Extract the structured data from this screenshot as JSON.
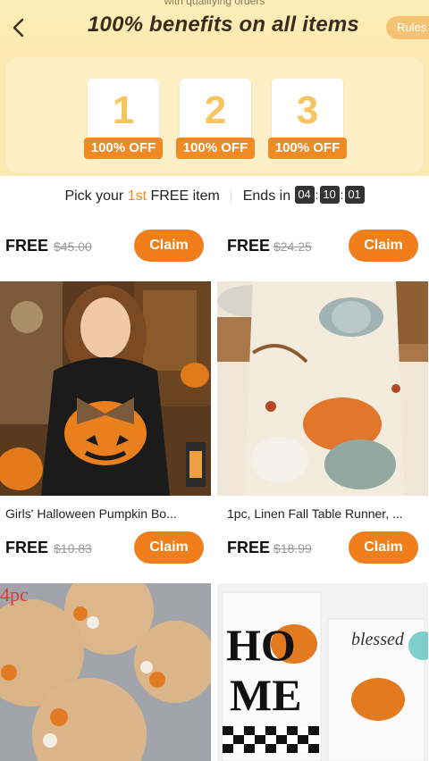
{
  "header": {
    "top_caption": "with qualifying orders",
    "title": "100% benefits on all items",
    "rules_label": "Rules"
  },
  "steps": [
    {
      "number": "1",
      "label": "100% OFF"
    },
    {
      "number": "2",
      "label": "100% OFF"
    },
    {
      "number": "3",
      "label": "100% OFF"
    }
  ],
  "pick": {
    "prefix": "Pick your ",
    "ordinal": "1st",
    "suffix": " FREE item",
    "ends_label": "Ends in",
    "hours": "04",
    "minutes": "10",
    "seconds": "01"
  },
  "products": [
    {
      "free": "FREE",
      "old_price": "$45.00",
      "claim": "Claim",
      "title": ""
    },
    {
      "free": "FREE",
      "old_price": "$24.25",
      "claim": "Claim",
      "title": ""
    },
    {
      "free": "FREE",
      "old_price": "$10.83",
      "claim": "Claim",
      "title": "Girls' Halloween Pumpkin Bo..."
    },
    {
      "free": "FREE",
      "old_price": "$18.99",
      "claim": "Claim",
      "title": "1pc, Linen Fall Table Runner, ..."
    }
  ],
  "next_row": {
    "left_badge": "4pc",
    "right_text_1": "HO",
    "right_text_2": "ME",
    "right_text_3": "blessed"
  },
  "colors": {
    "accent": "#f08a24",
    "claim": "#f07f1b",
    "header_bg": "#fbe9b0"
  }
}
